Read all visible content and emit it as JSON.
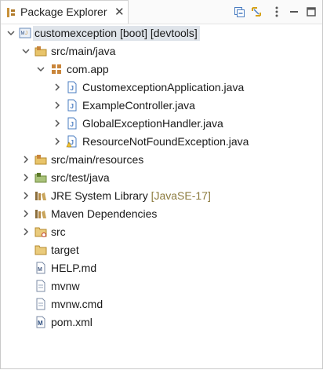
{
  "tab": {
    "title": "Package Explorer",
    "close": "✕"
  },
  "tree": {
    "project": {
      "name": "customexception [boot] [devtools]"
    },
    "src_main_java": "src/main/java",
    "package": "com.app",
    "files": [
      "CustomexceptionApplication.java",
      "ExampleController.java",
      "GlobalExceptionHandler.java",
      "ResourceNotFoundException.java"
    ],
    "src_main_resources": "src/main/resources",
    "src_test_java": "src/test/java",
    "jre": {
      "name": "JRE System Library",
      "decoration": "[JavaSE-17]"
    },
    "maven_deps": "Maven Dependencies",
    "src": "src",
    "target": "target",
    "help": "HELP.md",
    "mvnw": "mvnw",
    "mvnw_cmd": "mvnw.cmd",
    "pom": "pom.xml"
  }
}
